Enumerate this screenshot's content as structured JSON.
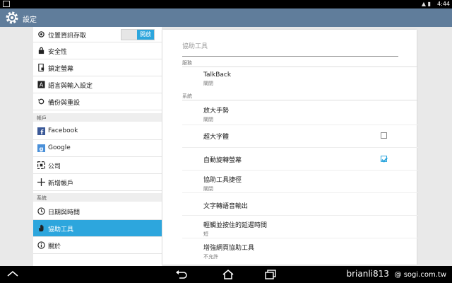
{
  "status_bar": {
    "time": "4:44"
  },
  "app_bar": {
    "title": "設定"
  },
  "left_pane": {
    "location_item": {
      "label": "位置資訊存取",
      "toggle_label": "開啟"
    },
    "items": [
      {
        "label": "安全性",
        "icon": "lock-icon"
      },
      {
        "label": "鎖定螢幕",
        "icon": "phone-lock-icon"
      },
      {
        "label": "語言與輸入設定",
        "icon": "keyboard-a-icon"
      },
      {
        "label": "備份與重設",
        "icon": "restore-icon"
      }
    ],
    "accounts_header": "帳戶",
    "accounts": [
      {
        "label": "Facebook",
        "icon": "facebook-icon"
      },
      {
        "label": "Google",
        "icon": "google-icon"
      },
      {
        "label": "公司",
        "icon": "work-icon"
      },
      {
        "label": "新增帳戶",
        "icon": "plus-icon"
      }
    ],
    "system_header": "系統",
    "system": [
      {
        "label": "日期與時間",
        "icon": "clock-icon"
      },
      {
        "label": "協助工具",
        "icon": "hand-icon",
        "selected": true
      },
      {
        "label": "關於",
        "icon": "info-icon"
      }
    ]
  },
  "right_pane": {
    "title": "協助工具",
    "services_header": "服務",
    "talkback": {
      "title": "TalkBack",
      "summary": "關閉"
    },
    "system_header": "系統",
    "magnification": {
      "title": "放大手勢",
      "summary": "關閉"
    },
    "large_text": {
      "title": "超大字體",
      "checked": false
    },
    "auto_rotate": {
      "title": "自動旋轉螢幕",
      "checked": true
    },
    "shortcut": {
      "title": "協助工具捷徑",
      "summary": "關閉"
    },
    "tts": {
      "title": "文字轉語音輸出"
    },
    "touch_hold": {
      "title": "輕觸並按住的延遲時間",
      "summary": "短"
    },
    "web_access": {
      "title": "增強網頁協助工具",
      "summary": "不允許"
    }
  },
  "watermark": {
    "user": "brianli813",
    "site": "@ sogi.com.tw"
  },
  "colors": {
    "accent": "#2da6dd",
    "app_bar": "#607d9b"
  }
}
